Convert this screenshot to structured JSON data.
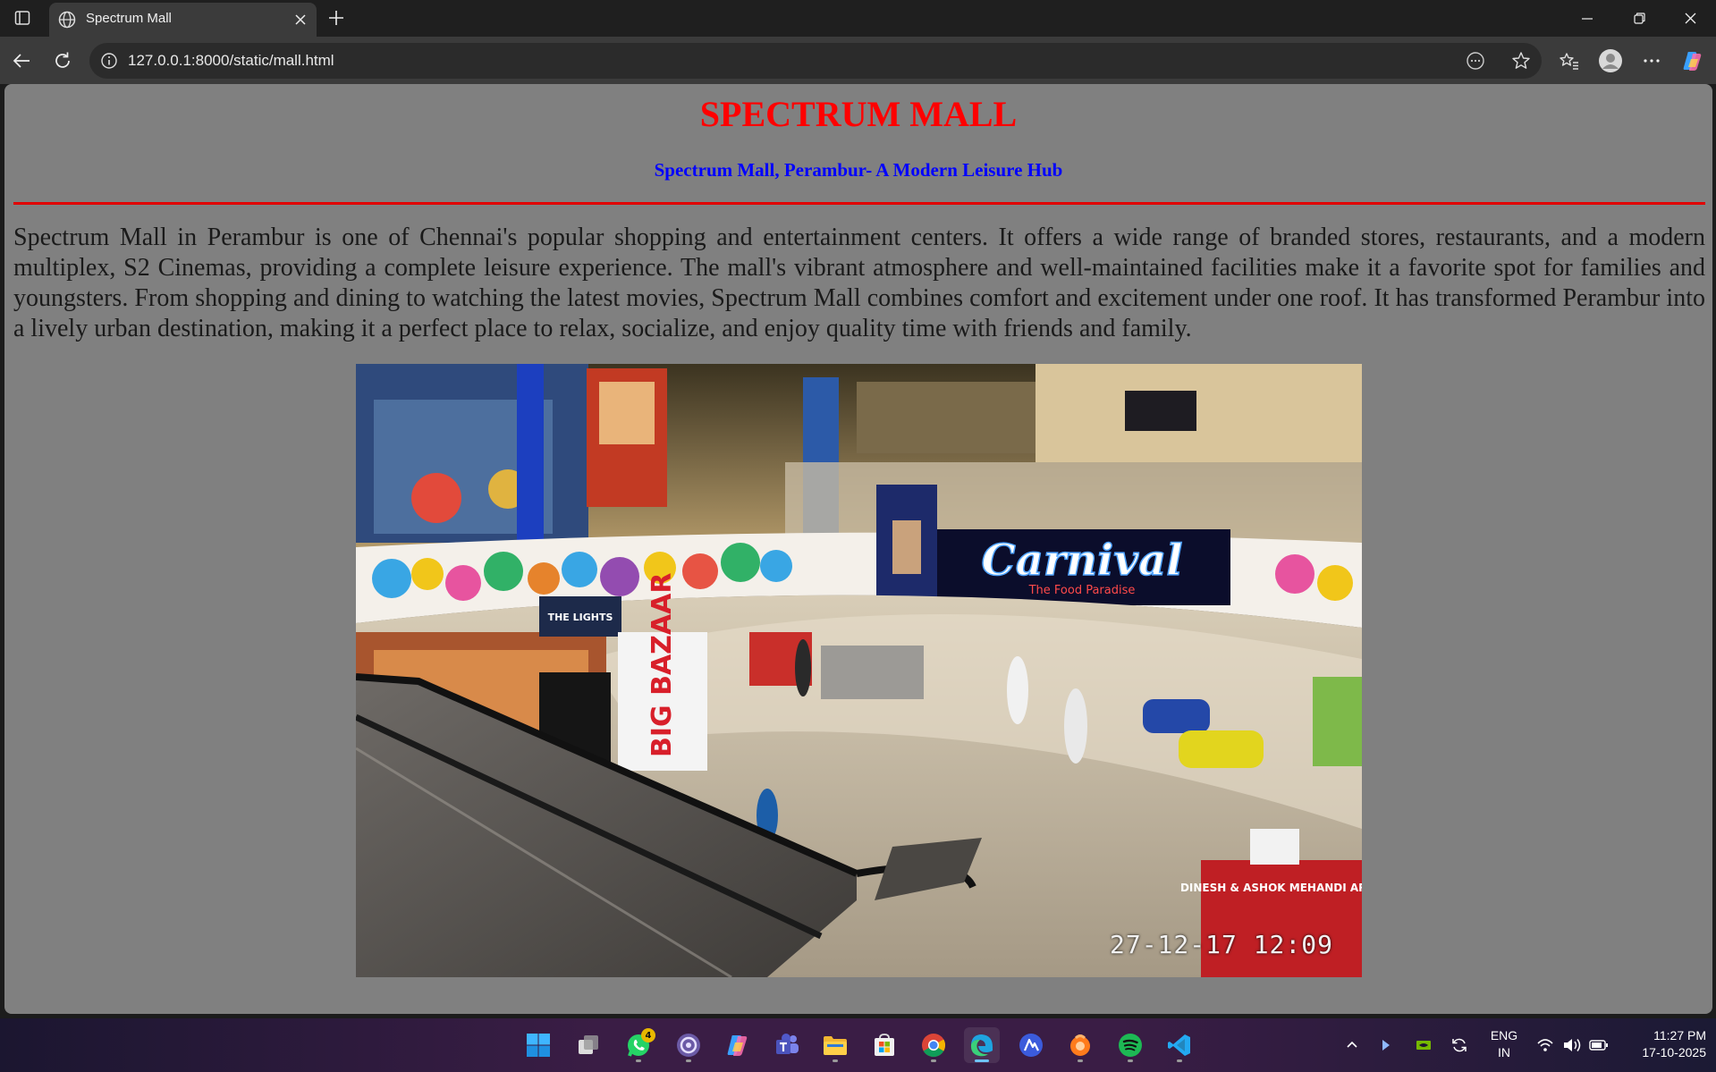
{
  "browser": {
    "tab": {
      "title": "Spectrum Mall"
    },
    "address_bar": {
      "url": "127.0.0.1:8000/static/mall.html"
    }
  },
  "page": {
    "title": "SPECTRUM MALL",
    "subtitle": "Spectrum Mall, Perambur- A Modern Leisure Hub",
    "paragraph": "Spectrum Mall in Perambur is one of Chennai's popular shopping and entertainment centers. It offers a wide range of branded stores, restaurants, and a modern multiplex, S2 Cinemas, providing a complete leisure experience. The mall's vibrant atmosphere and well-maintained facilities make it a favorite spot for families and youngsters. From shopping and dining to watching the latest movies, Spectrum Mall combines comfort and excitement under one roof. It has transformed Perambur into a lively urban destination, making it a perfect place to relax, socialize, and enjoy quality time with friends and family.",
    "image": {
      "timestamp": "27-12-17 12:09",
      "signs": [
        "Carnival",
        "The Food Paradise",
        "THE LIGHTS",
        "BIG BAZAAR",
        "DINESH & ASHOK MEHANDI ART"
      ]
    },
    "colors": {
      "title": "#ff0000",
      "subtitle": "#0000ff",
      "rule": "#e00000",
      "background": "#808080"
    }
  },
  "taskbar": {
    "apps": [
      "start",
      "task-view",
      "whatsapp",
      "app-circle",
      "copilot",
      "teams",
      "file-explorer",
      "microsoft-store",
      "chrome",
      "edge",
      "app-triangle",
      "app-orange",
      "spotify",
      "vscode"
    ],
    "whatsapp_badge": "4",
    "language": {
      "line1": "ENG",
      "line2": "IN"
    },
    "clock": {
      "time": "11:27 PM",
      "date": "17-10-2025"
    }
  }
}
